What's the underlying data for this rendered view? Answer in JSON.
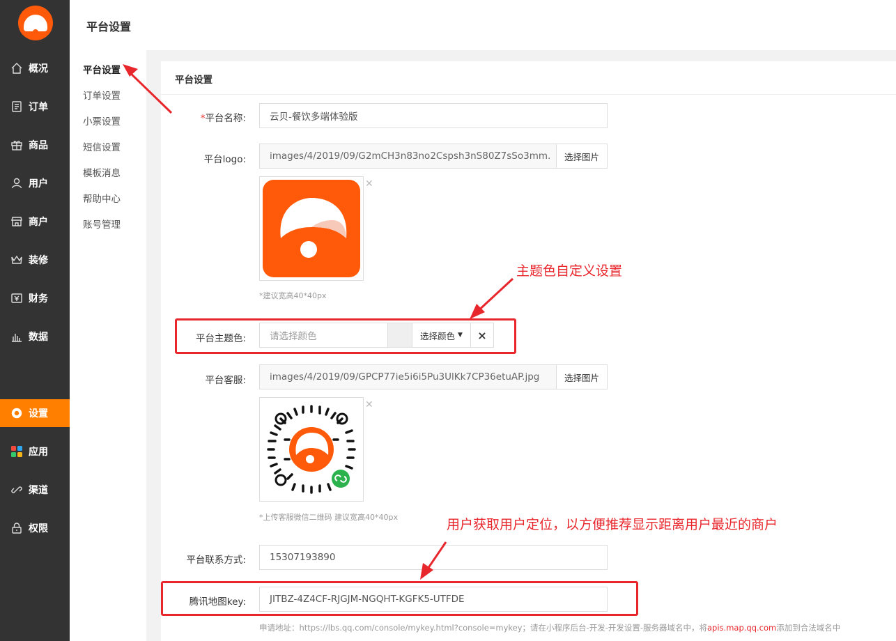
{
  "nav": {
    "items": [
      {
        "label": "概况",
        "icon": "home-icon"
      },
      {
        "label": "订单",
        "icon": "order-icon"
      },
      {
        "label": "商品",
        "icon": "gift-icon"
      },
      {
        "label": "用户",
        "icon": "user-icon"
      },
      {
        "label": "商户",
        "icon": "store-icon"
      },
      {
        "label": "装修",
        "icon": "crown-icon"
      },
      {
        "label": "财务",
        "icon": "finance-icon"
      },
      {
        "label": "数据",
        "icon": "chart-icon"
      },
      {
        "label": "设置",
        "icon": "gear-icon",
        "active": true
      },
      {
        "label": "应用",
        "icon": "apps-icon"
      },
      {
        "label": "渠道",
        "icon": "link-icon"
      },
      {
        "label": "权限",
        "icon": "lock-icon"
      }
    ]
  },
  "header": {
    "title": "平台设置"
  },
  "subnav": {
    "items": [
      "平台设置",
      "订单设置",
      "小票设置",
      "短信设置",
      "模板消息",
      "帮助中心",
      "账号管理"
    ]
  },
  "panel": {
    "title": "平台设置",
    "platform_name": {
      "label": "平台名称:",
      "required_mark": "*",
      "value": "云贝-餐饮多端体验版"
    },
    "platform_logo": {
      "label": "平台logo:",
      "value": "images/4/2019/09/G2mCH3n83no2Cspsh3nS80Z7sSo3mm.",
      "button": "选择图片",
      "hint": "*建议宽高40*40px"
    },
    "theme_color": {
      "label": "平台主题色:",
      "placeholder": "请选择颜色",
      "button": "选择颜色",
      "clear": "×"
    },
    "customer_service": {
      "label": "平台客服:",
      "value": "images/4/2019/09/GPCP77ie5i6i5Pu3UlKk7CP36etuAP.jpg",
      "button": "选择图片",
      "hint": "*上传客服微信二维码 建议宽高40*40px"
    },
    "contact": {
      "label": "平台联系方式:",
      "value": "15307193890"
    },
    "map_key": {
      "label": "腾讯地图key:",
      "value": "JITBZ-4Z4CF-RJGJM-NGQHT-KGFK5-UTFDE"
    },
    "map_hint": {
      "prefix": "申请地址：https://lbs.qq.com/console/mykey.html?console=mykey；请在小程序后台-开发-开发设置-服务器域名中，将",
      "domain": "apis.map.qq.com",
      "suffix": "添加到合法域名中"
    }
  },
  "annotations": {
    "theme": "主题色自定义设置",
    "location": "用户获取用户定位，以方便推荐显示距离用户最近的商户"
  },
  "colors": {
    "brand": "#ff5a0a",
    "active_nav": "#ff8000",
    "annotation": "#e8272d",
    "link": "#e8272d"
  }
}
